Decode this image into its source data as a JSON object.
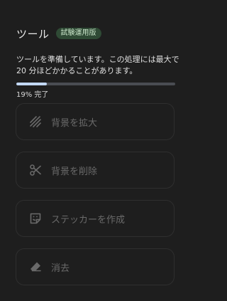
{
  "header": {
    "title": "ツール",
    "badge": "試験運用版"
  },
  "status": {
    "description": "ツールを準備しています。この処理には最大で 20 分ほどかかることがあります。",
    "progress_percent": 19,
    "progress_label": "19% 完了"
  },
  "tools": [
    {
      "label": "背景を拡大",
      "icon": "expand-background-icon",
      "enabled": false
    },
    {
      "label": "背景を削除",
      "icon": "scissors-icon",
      "enabled": false
    },
    {
      "label": "ステッカーを作成",
      "icon": "sticker-icon",
      "enabled": false
    },
    {
      "label": "消去",
      "icon": "eraser-icon",
      "enabled": false
    }
  ],
  "colors": {
    "background": "#1e1e1e",
    "badge_bg": "#2f4a35",
    "badge_text": "#c9e4c9",
    "progress_fill": "#c2d8f5",
    "progress_track": "#4a4d52",
    "disabled_text": "#6a6a6a"
  }
}
